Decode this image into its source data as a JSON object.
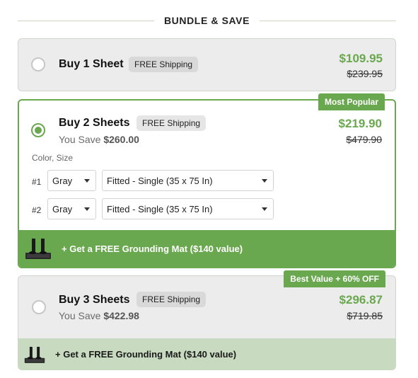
{
  "header": {
    "title": "BUNDLE & SAVE"
  },
  "options": [
    {
      "title": "Buy 1 Sheet",
      "shipping": "FREE Shipping",
      "price": "$109.95",
      "was": "$239.95",
      "selected": false
    },
    {
      "title": "Buy 2 Sheets",
      "shipping": "FREE Shipping",
      "save_prefix": "You Save",
      "save_amount": "$260.00",
      "price": "$219.90",
      "was": "$479.90",
      "ribbon": "Most Popular",
      "selected": true,
      "selector_label": "Color, Size",
      "rows": [
        {
          "num": "#1",
          "color": "Gray",
          "size": "Fitted - Single (35 x 75 In)"
        },
        {
          "num": "#2",
          "color": "Gray",
          "size": "Fitted - Single (35 x 75 In)"
        }
      ],
      "promo": "+ Get a FREE Grounding Mat ($140 value)"
    },
    {
      "title": "Buy 3 Sheets",
      "shipping": "FREE Shipping",
      "save_prefix": "You Save",
      "save_amount": "$422.98",
      "price": "$296.87",
      "was": "$719.85",
      "ribbon": "Best Value + 60% OFF",
      "selected": false,
      "promo": "+ Get a FREE Grounding Mat ($140 value)"
    }
  ],
  "colors": {
    "accent": "#6aa84f",
    "card_grey": "#ececec",
    "promo_light": "#c8dbc0"
  },
  "icons": {
    "radio": "radio-button",
    "caret": "chevron-down-icon",
    "mat": "grounding-mat-icon"
  }
}
